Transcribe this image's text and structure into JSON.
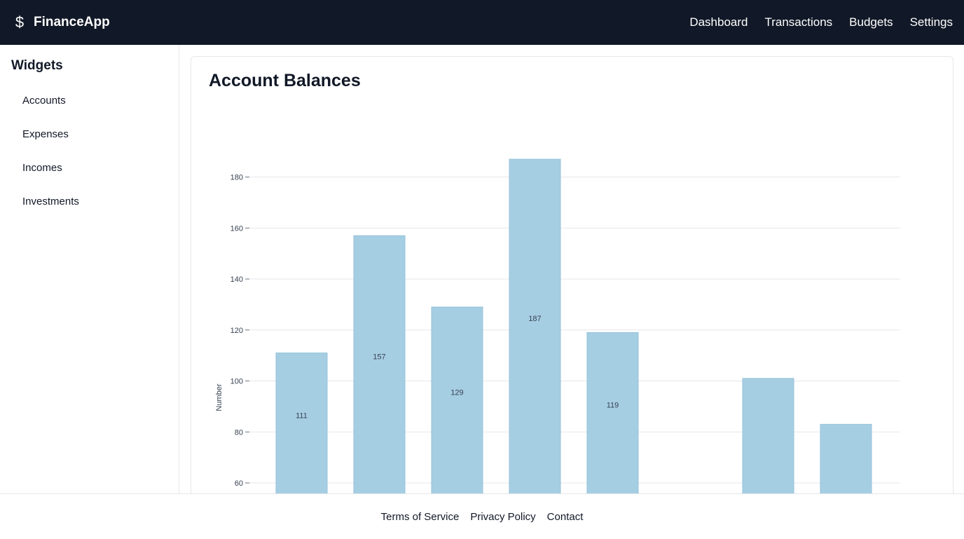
{
  "app": {
    "name": "FinanceApp",
    "logo_icon": "dollar-sign-icon",
    "logo_glyph": "$"
  },
  "nav": {
    "items": [
      {
        "label": "Dashboard"
      },
      {
        "label": "Transactions"
      },
      {
        "label": "Budgets"
      },
      {
        "label": "Settings"
      }
    ]
  },
  "sidebar": {
    "title": "Widgets",
    "items": [
      {
        "label": "Accounts"
      },
      {
        "label": "Expenses"
      },
      {
        "label": "Incomes"
      },
      {
        "label": "Investments"
      }
    ]
  },
  "main": {
    "title": "Account Balances"
  },
  "chart_data": {
    "type": "bar",
    "title": "Account Balances",
    "ylabel": "Number",
    "xlabel": "",
    "yticks": [
      60,
      80,
      100,
      120,
      140,
      160,
      180
    ],
    "grid": true,
    "values": [
      111,
      157,
      129,
      187,
      119,
      null,
      101,
      83
    ],
    "data_labels": [
      "111",
      "157",
      "129",
      "187",
      "119",
      "",
      "",
      ""
    ],
    "bar_color": "#a6cee3"
  },
  "footer": {
    "links": [
      {
        "label": "Terms of Service"
      },
      {
        "label": "Privacy Policy"
      },
      {
        "label": "Contact"
      }
    ]
  },
  "colors": {
    "topbar_bg": "#111827",
    "border": "#e5e7eb",
    "grid": "#e5e7eb"
  }
}
